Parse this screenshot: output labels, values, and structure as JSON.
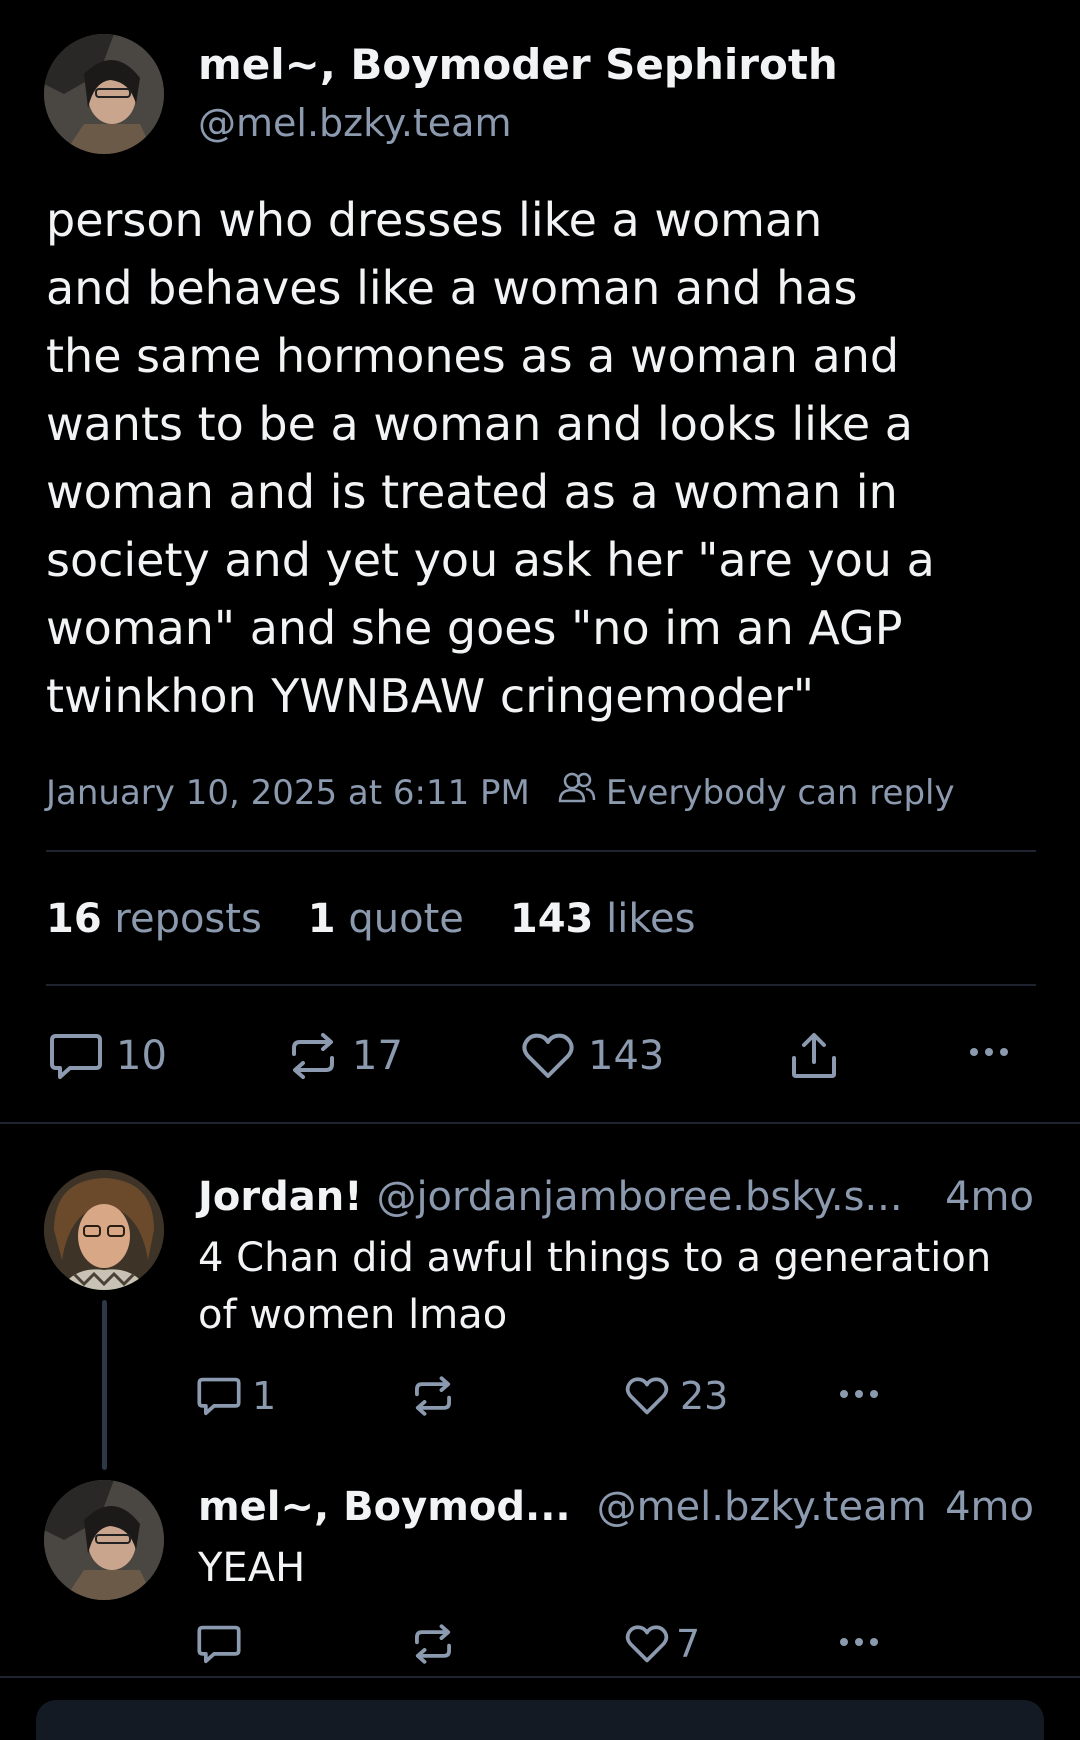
{
  "main_post": {
    "display_name": "mel~, Boymoder Sephiroth",
    "handle": "@mel.bzky.team",
    "text_lines": [
      "person who dresses like a woman",
      "and behaves like a woman and has",
      "the same hormones as a woman and",
      "wants to be a woman and looks like a",
      "woman and is treated as a woman in",
      "society and yet you ask her \"are you a",
      "woman\" and she goes \"no im an AGP",
      "twinkhon YWNBAW cringemoder\""
    ],
    "timestamp": "January 10, 2025 at 6:11 PM",
    "reply_setting": "Everybody can reply",
    "reposts_count": "16",
    "reposts_label": "reposts",
    "quotes_count": "1",
    "quotes_label": "quote",
    "likes_count": "143",
    "likes_label": "likes",
    "actions": {
      "replies": "10",
      "reposts": "17",
      "likes": "143"
    }
  },
  "replies": [
    {
      "display_name": "Jordan!",
      "handle": "@jordanjamboree.bsky.s...",
      "age": "4mo",
      "text_lines": [
        "4 Chan did awful things to a generation",
        "of women lmao"
      ],
      "reply_count": "1",
      "repost_count": "",
      "like_count": "23"
    },
    {
      "display_name": "mel~, Boymod...",
      "handle": "@mel.bzky.team",
      "age": "4mo",
      "text_lines": [
        "YEAH"
      ],
      "reply_count": "",
      "repost_count": "",
      "like_count": "7"
    }
  ],
  "icons": {
    "reply": "speech-bubble-icon",
    "repost": "repost-arrows-icon",
    "like": "heart-icon",
    "share": "share-upload-icon",
    "more": "ellipsis-icon",
    "audience": "people-icon"
  },
  "colors": {
    "background": "#000000",
    "text": "#f1f3f5",
    "muted": "#8c9aaf",
    "divider": "#1e2430"
  }
}
